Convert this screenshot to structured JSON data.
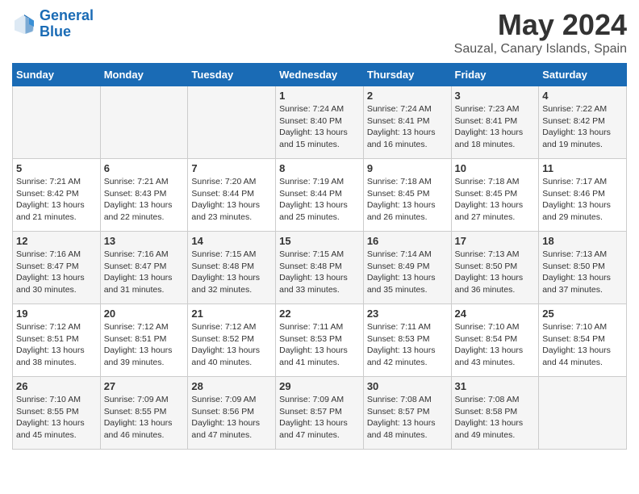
{
  "logo": {
    "line1": "General",
    "line2": "Blue"
  },
  "title": "May 2024",
  "subtitle": "Sauzal, Canary Islands, Spain",
  "days_of_week": [
    "Sunday",
    "Monday",
    "Tuesday",
    "Wednesday",
    "Thursday",
    "Friday",
    "Saturday"
  ],
  "weeks": [
    [
      {
        "day": "",
        "info": ""
      },
      {
        "day": "",
        "info": ""
      },
      {
        "day": "",
        "info": ""
      },
      {
        "day": "1",
        "info": "Sunrise: 7:24 AM\nSunset: 8:40 PM\nDaylight: 13 hours\nand 15 minutes."
      },
      {
        "day": "2",
        "info": "Sunrise: 7:24 AM\nSunset: 8:41 PM\nDaylight: 13 hours\nand 16 minutes."
      },
      {
        "day": "3",
        "info": "Sunrise: 7:23 AM\nSunset: 8:41 PM\nDaylight: 13 hours\nand 18 minutes."
      },
      {
        "day": "4",
        "info": "Sunrise: 7:22 AM\nSunset: 8:42 PM\nDaylight: 13 hours\nand 19 minutes."
      }
    ],
    [
      {
        "day": "5",
        "info": "Sunrise: 7:21 AM\nSunset: 8:42 PM\nDaylight: 13 hours\nand 21 minutes."
      },
      {
        "day": "6",
        "info": "Sunrise: 7:21 AM\nSunset: 8:43 PM\nDaylight: 13 hours\nand 22 minutes."
      },
      {
        "day": "7",
        "info": "Sunrise: 7:20 AM\nSunset: 8:44 PM\nDaylight: 13 hours\nand 23 minutes."
      },
      {
        "day": "8",
        "info": "Sunrise: 7:19 AM\nSunset: 8:44 PM\nDaylight: 13 hours\nand 25 minutes."
      },
      {
        "day": "9",
        "info": "Sunrise: 7:18 AM\nSunset: 8:45 PM\nDaylight: 13 hours\nand 26 minutes."
      },
      {
        "day": "10",
        "info": "Sunrise: 7:18 AM\nSunset: 8:45 PM\nDaylight: 13 hours\nand 27 minutes."
      },
      {
        "day": "11",
        "info": "Sunrise: 7:17 AM\nSunset: 8:46 PM\nDaylight: 13 hours\nand 29 minutes."
      }
    ],
    [
      {
        "day": "12",
        "info": "Sunrise: 7:16 AM\nSunset: 8:47 PM\nDaylight: 13 hours\nand 30 minutes."
      },
      {
        "day": "13",
        "info": "Sunrise: 7:16 AM\nSunset: 8:47 PM\nDaylight: 13 hours\nand 31 minutes."
      },
      {
        "day": "14",
        "info": "Sunrise: 7:15 AM\nSunset: 8:48 PM\nDaylight: 13 hours\nand 32 minutes."
      },
      {
        "day": "15",
        "info": "Sunrise: 7:15 AM\nSunset: 8:48 PM\nDaylight: 13 hours\nand 33 minutes."
      },
      {
        "day": "16",
        "info": "Sunrise: 7:14 AM\nSunset: 8:49 PM\nDaylight: 13 hours\nand 35 minutes."
      },
      {
        "day": "17",
        "info": "Sunrise: 7:13 AM\nSunset: 8:50 PM\nDaylight: 13 hours\nand 36 minutes."
      },
      {
        "day": "18",
        "info": "Sunrise: 7:13 AM\nSunset: 8:50 PM\nDaylight: 13 hours\nand 37 minutes."
      }
    ],
    [
      {
        "day": "19",
        "info": "Sunrise: 7:12 AM\nSunset: 8:51 PM\nDaylight: 13 hours\nand 38 minutes."
      },
      {
        "day": "20",
        "info": "Sunrise: 7:12 AM\nSunset: 8:51 PM\nDaylight: 13 hours\nand 39 minutes."
      },
      {
        "day": "21",
        "info": "Sunrise: 7:12 AM\nSunset: 8:52 PM\nDaylight: 13 hours\nand 40 minutes."
      },
      {
        "day": "22",
        "info": "Sunrise: 7:11 AM\nSunset: 8:53 PM\nDaylight: 13 hours\nand 41 minutes."
      },
      {
        "day": "23",
        "info": "Sunrise: 7:11 AM\nSunset: 8:53 PM\nDaylight: 13 hours\nand 42 minutes."
      },
      {
        "day": "24",
        "info": "Sunrise: 7:10 AM\nSunset: 8:54 PM\nDaylight: 13 hours\nand 43 minutes."
      },
      {
        "day": "25",
        "info": "Sunrise: 7:10 AM\nSunset: 8:54 PM\nDaylight: 13 hours\nand 44 minutes."
      }
    ],
    [
      {
        "day": "26",
        "info": "Sunrise: 7:10 AM\nSunset: 8:55 PM\nDaylight: 13 hours\nand 45 minutes."
      },
      {
        "day": "27",
        "info": "Sunrise: 7:09 AM\nSunset: 8:55 PM\nDaylight: 13 hours\nand 46 minutes."
      },
      {
        "day": "28",
        "info": "Sunrise: 7:09 AM\nSunset: 8:56 PM\nDaylight: 13 hours\nand 47 minutes."
      },
      {
        "day": "29",
        "info": "Sunrise: 7:09 AM\nSunset: 8:57 PM\nDaylight: 13 hours\nand 47 minutes."
      },
      {
        "day": "30",
        "info": "Sunrise: 7:08 AM\nSunset: 8:57 PM\nDaylight: 13 hours\nand 48 minutes."
      },
      {
        "day": "31",
        "info": "Sunrise: 7:08 AM\nSunset: 8:58 PM\nDaylight: 13 hours\nand 49 minutes."
      },
      {
        "day": "",
        "info": ""
      }
    ]
  ]
}
